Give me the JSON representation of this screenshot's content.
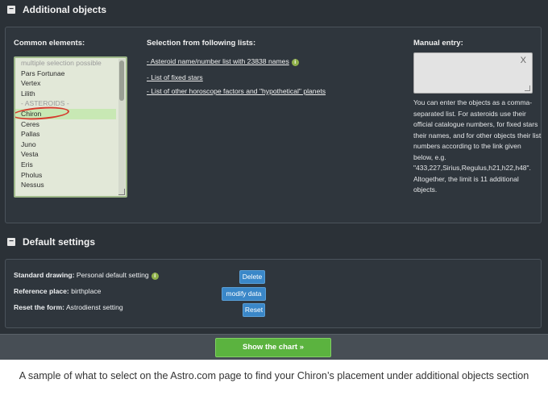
{
  "additional_objects": {
    "title": "Additional objects",
    "toggle_symbol": "−",
    "common_elements": {
      "title": "Common elements:",
      "options": [
        {
          "label": "multiple selection possible",
          "kind": "hint"
        },
        {
          "label": "Pars Fortunae",
          "kind": "item"
        },
        {
          "label": "Vertex",
          "kind": "item"
        },
        {
          "label": "Lilith",
          "kind": "item"
        },
        {
          "label": "- ASTEROIDS -",
          "kind": "group"
        },
        {
          "label": "Chiron",
          "kind": "selected"
        },
        {
          "label": "Ceres",
          "kind": "item"
        },
        {
          "label": "Pallas",
          "kind": "item"
        },
        {
          "label": "Juno",
          "kind": "item"
        },
        {
          "label": "Vesta",
          "kind": "item"
        },
        {
          "label": "Eris",
          "kind": "item"
        },
        {
          "label": "Pholus",
          "kind": "item"
        },
        {
          "label": "Nessus",
          "kind": "item"
        }
      ]
    },
    "selection_lists": {
      "title": "Selection from following lists:",
      "links": [
        "- Asteroid name/number list with 23838 names",
        "- List of fixed stars",
        "- List of other horoscope factors and \"hypothetical\" planets"
      ]
    },
    "manual_entry": {
      "title": "Manual entry:",
      "value": "",
      "clear_symbol": "X",
      "description": "You can enter the objects as a comma-separated list. For asteroids use their official catalogue numbers, for fixed stars their names, and for other objects their list numbers according to the link given below, e.g. \"433,227,Sirius,Regulus,h21,h22,h48\". Altogether, the limit is 11 additional objects."
    }
  },
  "default_settings": {
    "title": "Default settings",
    "toggle_symbol": "−",
    "rows": {
      "standard_drawing": {
        "label": "Standard drawing:",
        "value": "Personal default setting"
      },
      "reference_place": {
        "label": "Reference place:",
        "value": "birthplace"
      },
      "reset_form": {
        "label": "Reset the form:",
        "value": "Astrodienst setting"
      }
    },
    "buttons": {
      "delete": "Delete",
      "modify": "modify data",
      "reset": "Reset"
    }
  },
  "info_icon_glyph": "i",
  "show_chart_button": "Show the chart »",
  "caption": "A sample of what to select on the Astro.com page to find your Chiron’s placement under additional objects section",
  "colors": {
    "page_bg": "#2b3137",
    "listbox_bg": "#e2e8d8",
    "selected_bg": "#c8e8b4",
    "highlight_circle": "#d63a2c",
    "button_blue": "#3a87c8",
    "button_green": "#5bb33f",
    "info_icon": "#8fb04a"
  }
}
